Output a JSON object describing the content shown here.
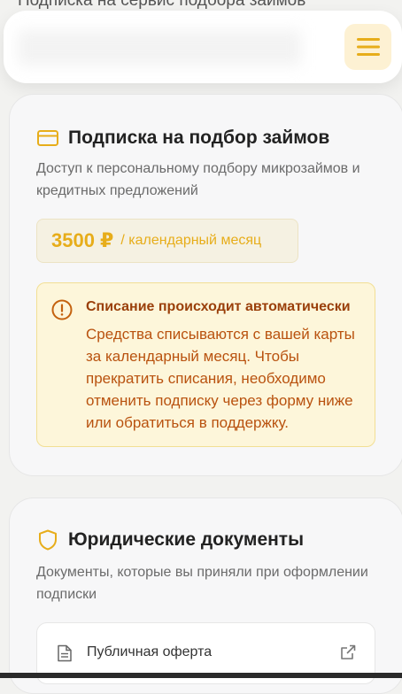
{
  "header": {
    "menu_icon": "hamburger-menu-icon"
  },
  "subscription": {
    "icon": "credit-card-icon",
    "title": "Подписка на подбор займов",
    "description": "Доступ к персональному подбору микрозаймов и кредитных предложений",
    "price_amount": "3500 ₽",
    "price_period": "/ календарный месяц",
    "warning": {
      "icon": "alert-circle-icon",
      "title": "Списание происходит автоматически",
      "text": "Средства списываются с вашей карты за календарный месяц. Чтобы прекратить списания, необходимо отменить подписку через форму ниже или обратиться в поддержку."
    }
  },
  "documents": {
    "icon": "shield-icon",
    "title": "Юридические документы",
    "description": "Документы, которые вы приняли при оформлении подписки",
    "items": [
      {
        "label": "Публичная оферта",
        "icon": "document-icon",
        "action_icon": "external-link-icon"
      }
    ]
  },
  "colors": {
    "accent": "#e7ad1a",
    "warning_text": "#b9520f",
    "warning_bg": "#fdf6da"
  }
}
